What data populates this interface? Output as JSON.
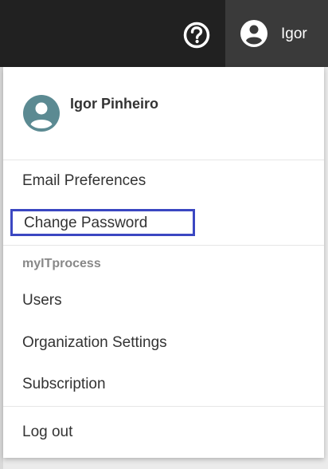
{
  "header": {
    "help_icon": "help-circle-icon",
    "account_icon": "account-circle-icon",
    "user_short_name": "Igor"
  },
  "menu": {
    "profile_name": "Igor Pinheiro",
    "email_preferences": "Email Preferences",
    "change_password": "Change Password",
    "section_label": "myITprocess",
    "users": "Users",
    "organization_settings": "Organization Settings",
    "subscription": "Subscription",
    "logout": "Log out"
  },
  "colors": {
    "topbar": "#212121",
    "user_button": "#3a3a3a",
    "avatar": "#5b8a92",
    "focus_outline": "#3b47c2"
  }
}
